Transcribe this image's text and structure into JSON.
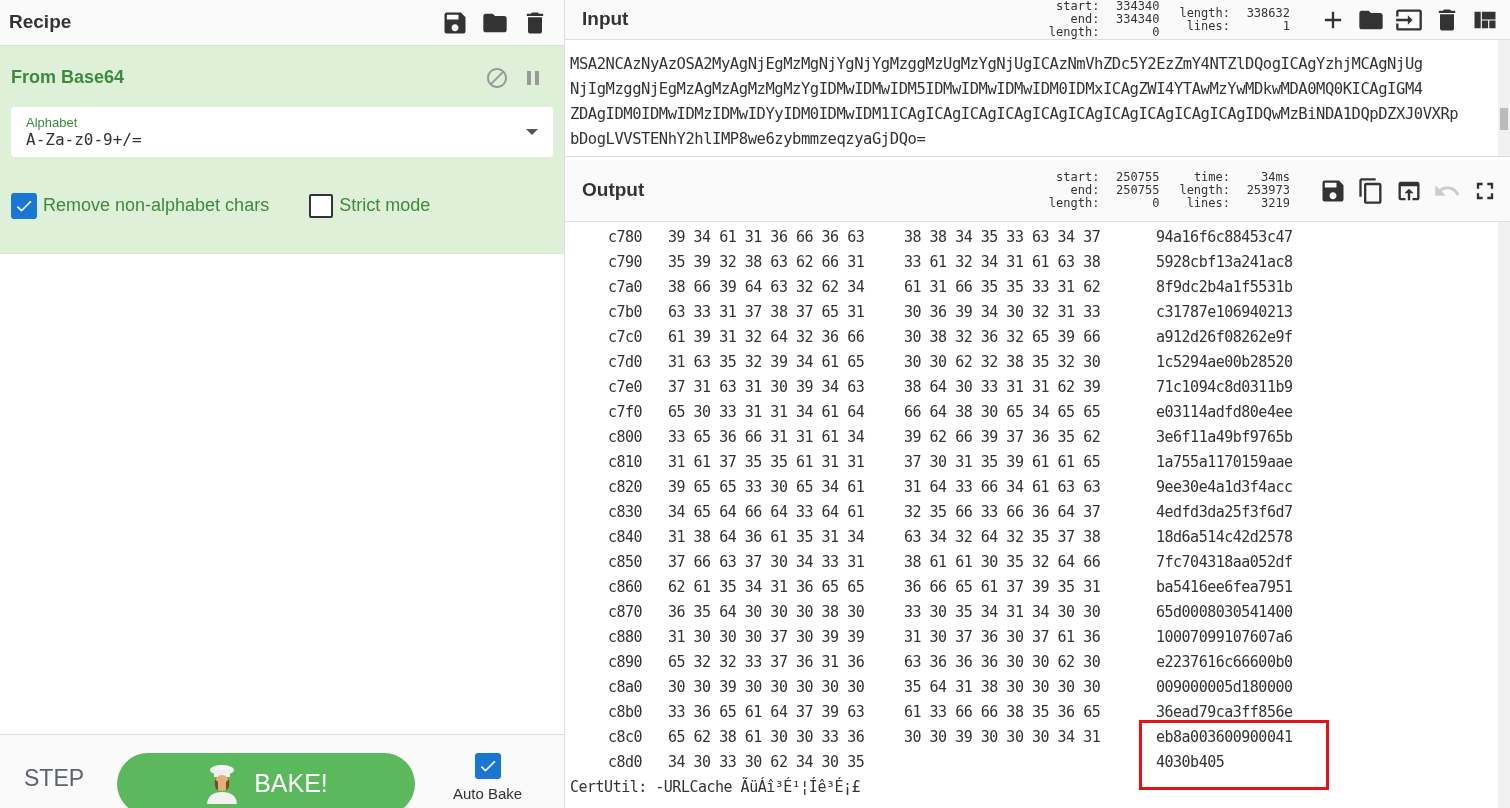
{
  "recipe": {
    "title": "Recipe",
    "operation": {
      "name": "From Base64",
      "disabled": false,
      "paused": false,
      "field": {
        "label": "Alphabet",
        "value": "A-Za-z0-9+/="
      },
      "options": [
        {
          "label": "Remove non-alphabet chars",
          "checked": true
        },
        {
          "label": "Strict mode",
          "checked": false
        }
      ]
    },
    "controls": {
      "step": "STEP",
      "bake": "BAKE!",
      "auto_bake": {
        "label": "Auto Bake",
        "checked": true
      }
    }
  },
  "input": {
    "title": "Input",
    "stats": [
      {
        "label": "start:",
        "value": "334340"
      },
      {
        "label": "end:",
        "value": "334340"
      },
      {
        "label": "length:",
        "value": "0"
      }
    ],
    "stats2": [
      {
        "label": "length:",
        "value": "338632"
      },
      {
        "label": "lines:",
        "value": "1"
      }
    ],
    "lines": [
      "MSA2NCAzNyAzOSA2MyAgNjEgMzMgNjYgNjYgMzggMzUgMzYgNjUgICAzNmVhZDc5Y2EzZmY4NTZlDQogICAgYzhjMCAgNjUg",
      "NjIgMzggNjEgMzAgMzAgMzMgMzYgIDMwIDMwIDM5IDMwIDMwIDMwIDM0IDMxICAgZWI4YTAwMzYwMDkwMDA0MQ0KICAgIGM4",
      "ZDAgIDM0IDMwIDMzIDMwIDYyIDM0IDMwIDM1ICAgICAgICAgICAgICAgICAgICAgICAgICAgICAgIDQwMzBiNDA1DQpDZXJ0VXRp",
      "bDogLVVSTENhY2hlIMP8we6zybmmzeqzyaGjDQo="
    ]
  },
  "output": {
    "title": "Output",
    "stats": [
      {
        "label": "start:",
        "value": "250755"
      },
      {
        "label": "end:",
        "value": "250755"
      },
      {
        "label": "length:",
        "value": "0"
      }
    ],
    "stats2": [
      {
        "label": "time:",
        "value": "34ms"
      },
      {
        "label": "length:",
        "value": "253973"
      },
      {
        "label": "lines:",
        "value": "3219"
      }
    ],
    "rows": [
      {
        "offset": "c780",
        "hex1": "39 34 61 31 36 66 36 63",
        "hex2": "38 38 34 35 33 63 34 37",
        "ascii": "94a16f6c88453c47"
      },
      {
        "offset": "c790",
        "hex1": "35 39 32 38 63 62 66 31",
        "hex2": "33 61 32 34 31 61 63 38",
        "ascii": "5928cbf13a241ac8"
      },
      {
        "offset": "c7a0",
        "hex1": "38 66 39 64 63 32 62 34",
        "hex2": "61 31 66 35 35 33 31 62",
        "ascii": "8f9dc2b4a1f5531b"
      },
      {
        "offset": "c7b0",
        "hex1": "63 33 31 37 38 37 65 31",
        "hex2": "30 36 39 34 30 32 31 33",
        "ascii": "c31787e106940213"
      },
      {
        "offset": "c7c0",
        "hex1": "61 39 31 32 64 32 36 66",
        "hex2": "30 38 32 36 32 65 39 66",
        "ascii": "a912d26f08262e9f"
      },
      {
        "offset": "c7d0",
        "hex1": "31 63 35 32 39 34 61 65",
        "hex2": "30 30 62 32 38 35 32 30",
        "ascii": "1c5294ae00b28520"
      },
      {
        "offset": "c7e0",
        "hex1": "37 31 63 31 30 39 34 63",
        "hex2": "38 64 30 33 31 31 62 39",
        "ascii": "71c1094c8d0311b9"
      },
      {
        "offset": "c7f0",
        "hex1": "65 30 33 31 31 34 61 64",
        "hex2": "66 64 38 30 65 34 65 65",
        "ascii": "e03114adfd80e4ee"
      },
      {
        "offset": "c800",
        "hex1": "33 65 36 66 31 31 61 34",
        "hex2": "39 62 66 39 37 36 35 62",
        "ascii": "3e6f11a49bf9765b"
      },
      {
        "offset": "c810",
        "hex1": "31 61 37 35 35 61 31 31",
        "hex2": "37 30 31 35 39 61 61 65",
        "ascii": "1a755a1170159aae"
      },
      {
        "offset": "c820",
        "hex1": "39 65 65 33 30 65 34 61",
        "hex2": "31 64 33 66 34 61 63 63",
        "ascii": "9ee30e4a1d3f4acc"
      },
      {
        "offset": "c830",
        "hex1": "34 65 64 66 64 33 64 61",
        "hex2": "32 35 66 33 66 36 64 37",
        "ascii": "4edfd3da25f3f6d7"
      },
      {
        "offset": "c840",
        "hex1": "31 38 64 36 61 35 31 34",
        "hex2": "63 34 32 64 32 35 37 38",
        "ascii": "18d6a514c42d2578"
      },
      {
        "offset": "c850",
        "hex1": "37 66 63 37 30 34 33 31",
        "hex2": "38 61 61 30 35 32 64 66",
        "ascii": "7fc704318aa052df"
      },
      {
        "offset": "c860",
        "hex1": "62 61 35 34 31 36 65 65",
        "hex2": "36 66 65 61 37 39 35 31",
        "ascii": "ba5416ee6fea7951"
      },
      {
        "offset": "c870",
        "hex1": "36 35 64 30 30 30 38 30",
        "hex2": "33 30 35 34 31 34 30 30",
        "ascii": "65d0008030541400"
      },
      {
        "offset": "c880",
        "hex1": "31 30 30 30 37 30 39 39",
        "hex2": "31 30 37 36 30 37 61 36",
        "ascii": "10007099107607a6"
      },
      {
        "offset": "c890",
        "hex1": "65 32 32 33 37 36 31 36",
        "hex2": "63 36 36 36 30 30 62 30",
        "ascii": "e2237616c66600b0"
      },
      {
        "offset": "c8a0",
        "hex1": "30 30 39 30 30 30 30 30",
        "hex2": "35 64 31 38 30 30 30 30",
        "ascii": "009000005d180000"
      },
      {
        "offset": "c8b0",
        "hex1": "33 36 65 61 64 37 39 63",
        "hex2": "61 33 66 66 38 35 36 65",
        "ascii": "36ead79ca3ff856e"
      },
      {
        "offset": "c8c0",
        "hex1": "65 62 38 61 30 30 33 36",
        "hex2": "30 30 39 30 30 30 34 31",
        "ascii": "eb8a003600900041"
      },
      {
        "offset": "c8d0",
        "hex1": "34 30 33 30 62 34 30 35",
        "ascii": "4030b405"
      }
    ],
    "trailer": "CertUtil: -URLCache ÃüÁî³É¹¦Íê³É¡£"
  }
}
